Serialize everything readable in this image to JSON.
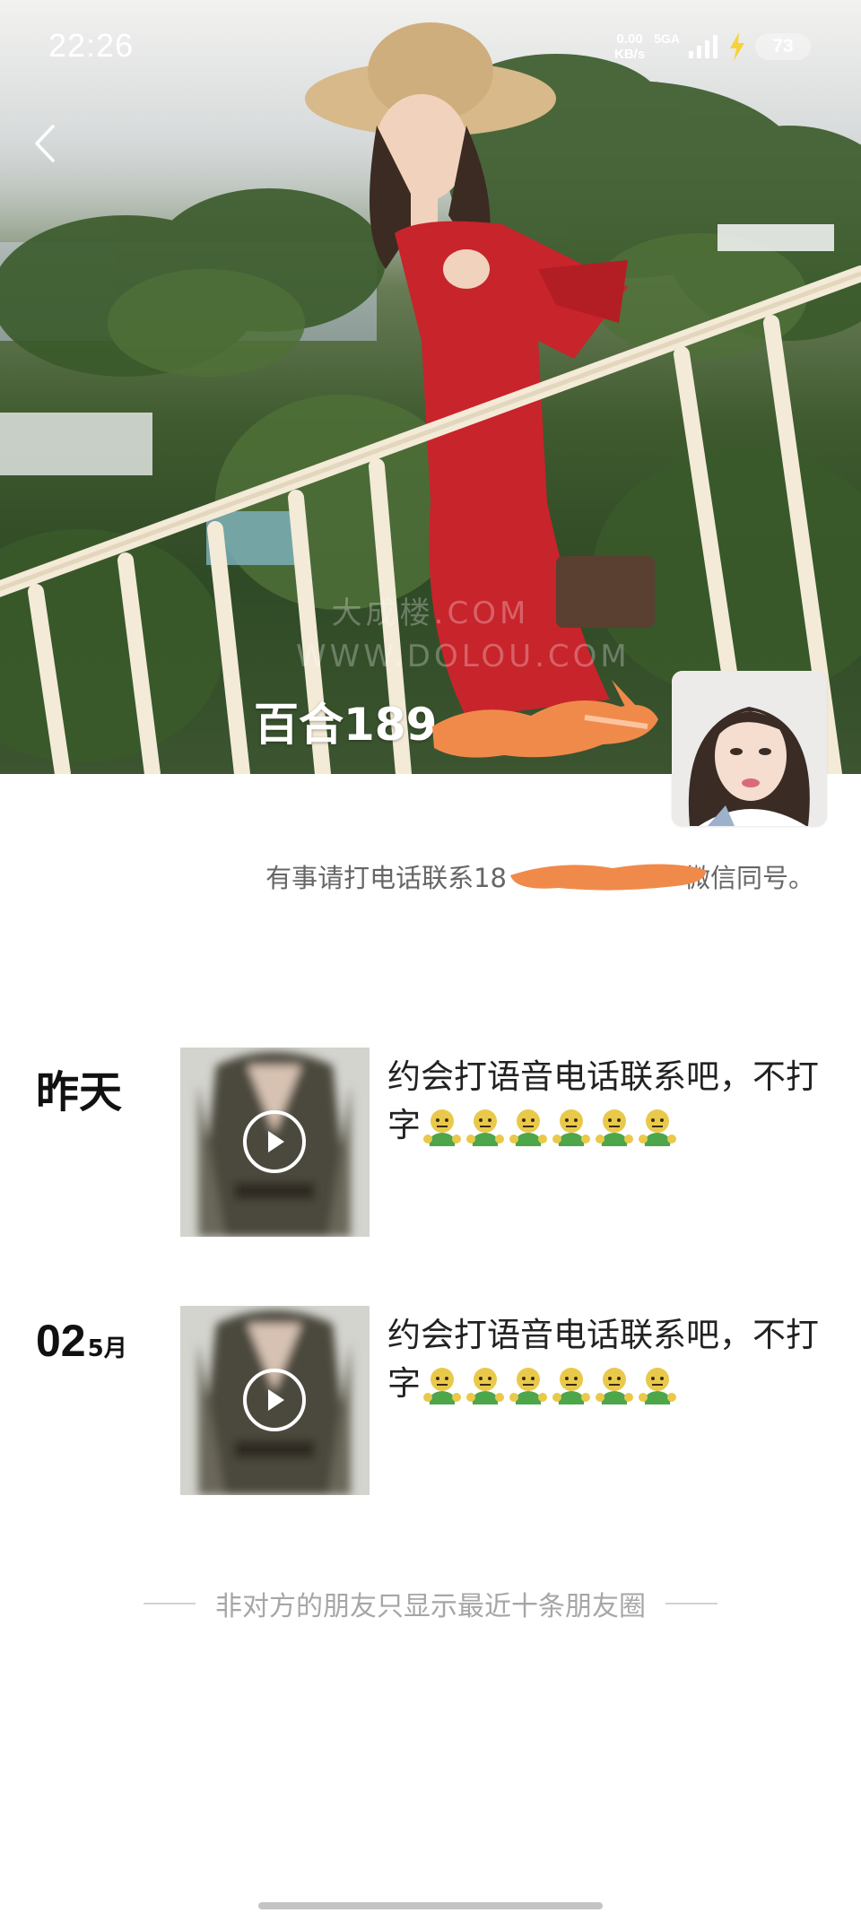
{
  "status_bar": {
    "time": "22:26",
    "net_speed_value": "0.00",
    "net_speed_unit": "KB/s",
    "network_type": "5GA",
    "battery": "73"
  },
  "profile": {
    "name": "百合189",
    "signature_start": "有事请打电话联系18",
    "signature_end": "微信同号。"
  },
  "cover_watermark": {
    "line1": "大成楼.COM",
    "line2": "WWW.DOLOU.COM"
  },
  "moments": [
    {
      "date": "昨天",
      "text": "约会打语音电话联系吧，不打字"
    },
    {
      "day": "02",
      "month": "5月",
      "text": "约会打语音电话联系吧，不打字"
    }
  ],
  "footer_note": "非对方的朋友只显示最近十条朋友圈",
  "colors": {
    "redaction": "#f08a4b",
    "secondary_text": "#a6a6a6"
  }
}
